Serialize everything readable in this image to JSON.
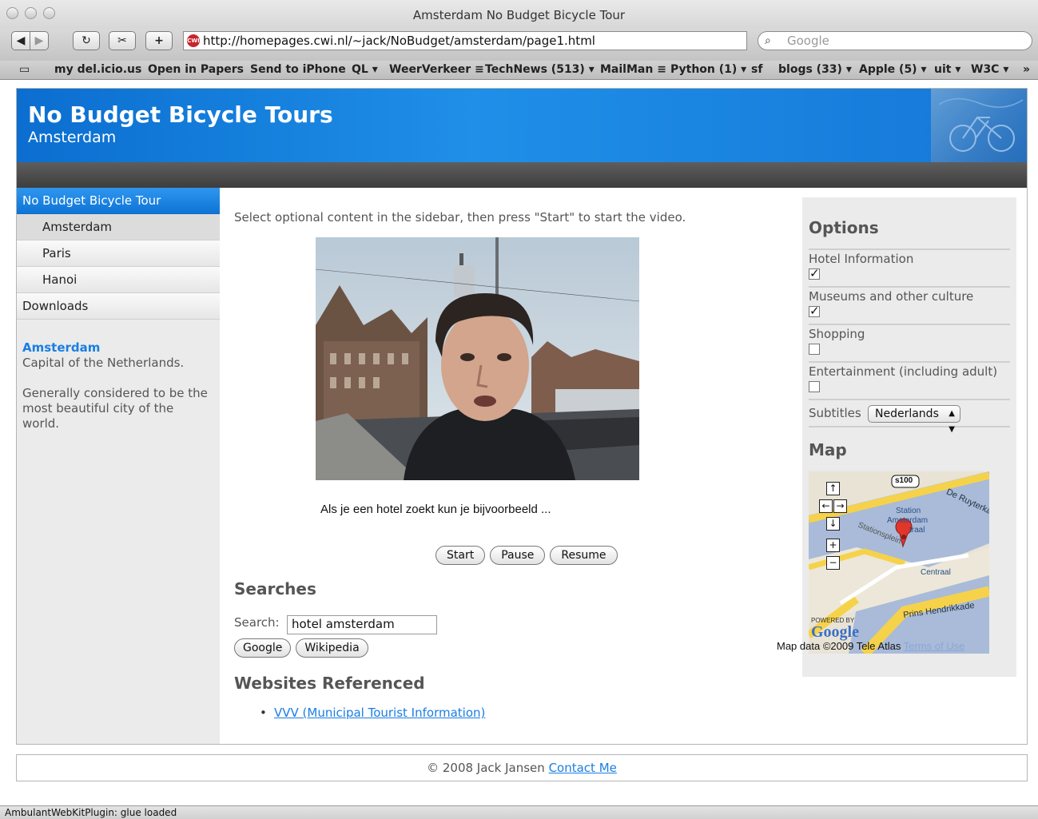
{
  "window": {
    "title": "Amsterdam No Budget Bicycle Tour"
  },
  "toolbar": {
    "back": "◀",
    "forward": "▶",
    "reload": "↻",
    "snip": "✂",
    "add": "+",
    "url": "http://homepages.cwi.nl/~jack/NoBudget/amsterdam/page1.html",
    "url_icon_text": "CWI",
    "search_placeholder": "Google"
  },
  "bookmarks": [
    "my del.icio.us",
    "Open in Papers",
    "Send to iPhone",
    "QL ▾",
    "WeerVerkeer ≡",
    "TechNews (513) ▾",
    "MailMan ≡",
    "Python (1) ▾",
    "sf",
    "blogs (33) ▾",
    "Apple (5) ▾",
    "uit ▾",
    "W3C ▾",
    "»"
  ],
  "banner": {
    "title": "No Budget Bicycle Tours",
    "subtitle": "Amsterdam"
  },
  "sidebar": {
    "nav": [
      {
        "label": "No Budget Bicycle Tour"
      },
      {
        "label": "Amsterdam"
      },
      {
        "label": "Paris"
      },
      {
        "label": "Hanoi"
      },
      {
        "label": "Downloads"
      }
    ],
    "info_city": "Amsterdam",
    "info_line1": "Capital of the Netherlands.",
    "info_line2": "Generally considered to be the most beautiful city of the world."
  },
  "main": {
    "intro": "Select optional content in the sidebar, then press \"Start\" to start the video.",
    "subtitle": "Als je een hotel zoekt kun je bijvoorbeeld ...",
    "controls": {
      "start": "Start",
      "pause": "Pause",
      "resume": "Resume"
    },
    "searches_heading": "Searches",
    "search_label": "Search:",
    "search_value": "hotel amsterdam",
    "search_buttons": {
      "google": "Google",
      "wikipedia": "Wikipedia"
    },
    "websites_heading": "Websites Referenced",
    "websites": [
      "VVV (Municipal Tourist Information)"
    ]
  },
  "options": {
    "heading": "Options",
    "items": [
      {
        "label": "Hotel Information",
        "checked": true
      },
      {
        "label": "Museums and other culture",
        "checked": true
      },
      {
        "label": "Shopping",
        "checked": false
      },
      {
        "label": "Entertainment (including adult)",
        "checked": false
      }
    ],
    "subtitles_label": "Subtitles",
    "subtitles_value": "Nederlands",
    "map_heading": "Map",
    "map_labels": {
      "road": "s100",
      "street1": "De Ruyterka",
      "station": "Station",
      "station2": "Amsterdam",
      "station3": "traal",
      "plein": "Stationsplein",
      "centraal": "Centraal",
      "prins": "Prins Hendrikkade",
      "powered": "POWERED BY",
      "google": "Google"
    },
    "map_data": "Map data ©2009 Tele Atlas",
    "map_terms": "Terms of Use"
  },
  "footer": {
    "copyright": "© 2008 Jack Jansen",
    "contact": "Contact Me"
  },
  "status": "AmbulantWebKitPlugin: glue loaded"
}
